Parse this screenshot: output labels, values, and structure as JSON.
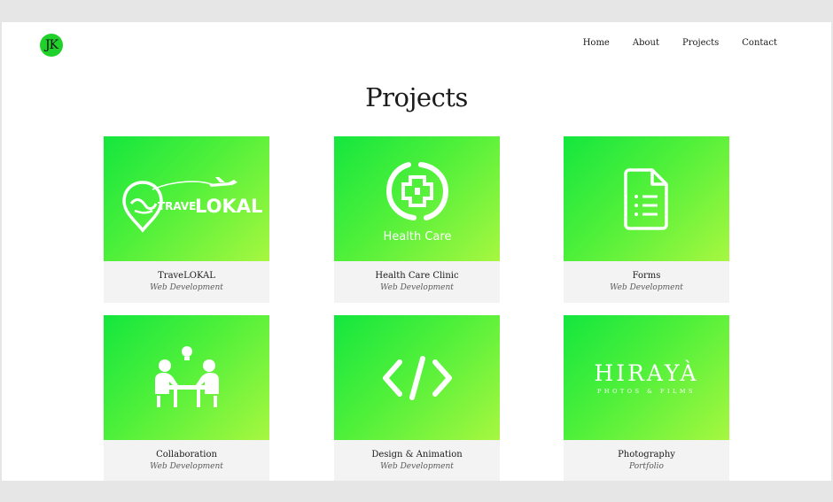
{
  "header": {
    "logo_text": "JK",
    "nav": [
      "Home",
      "About",
      "Projects",
      "Contact"
    ]
  },
  "title": "Projects",
  "projects": [
    {
      "name": "TraveLOKAL",
      "category": "Web Development",
      "logo_text": "TRAVE LOKAL"
    },
    {
      "name": "Health Care Clinic",
      "category": "Web Development",
      "logo_text": "Health Care"
    },
    {
      "name": "Forms",
      "category": "Web Development"
    },
    {
      "name": "Collaboration",
      "category": "Web Development"
    },
    {
      "name": "Design & Animation",
      "category": "Web Development"
    },
    {
      "name": "Photography",
      "category": "Portfolio",
      "logo_text": "HIRAYÀ",
      "logo_subtext": "PHOTOS & FILMS"
    }
  ],
  "colors": {
    "accent": "#1fd12a",
    "card_gradient_start": "#14e63e",
    "card_gradient_end": "#a7f740",
    "caption_bg": "#f3f3f3",
    "frame_bg": "#e6e6e6"
  }
}
